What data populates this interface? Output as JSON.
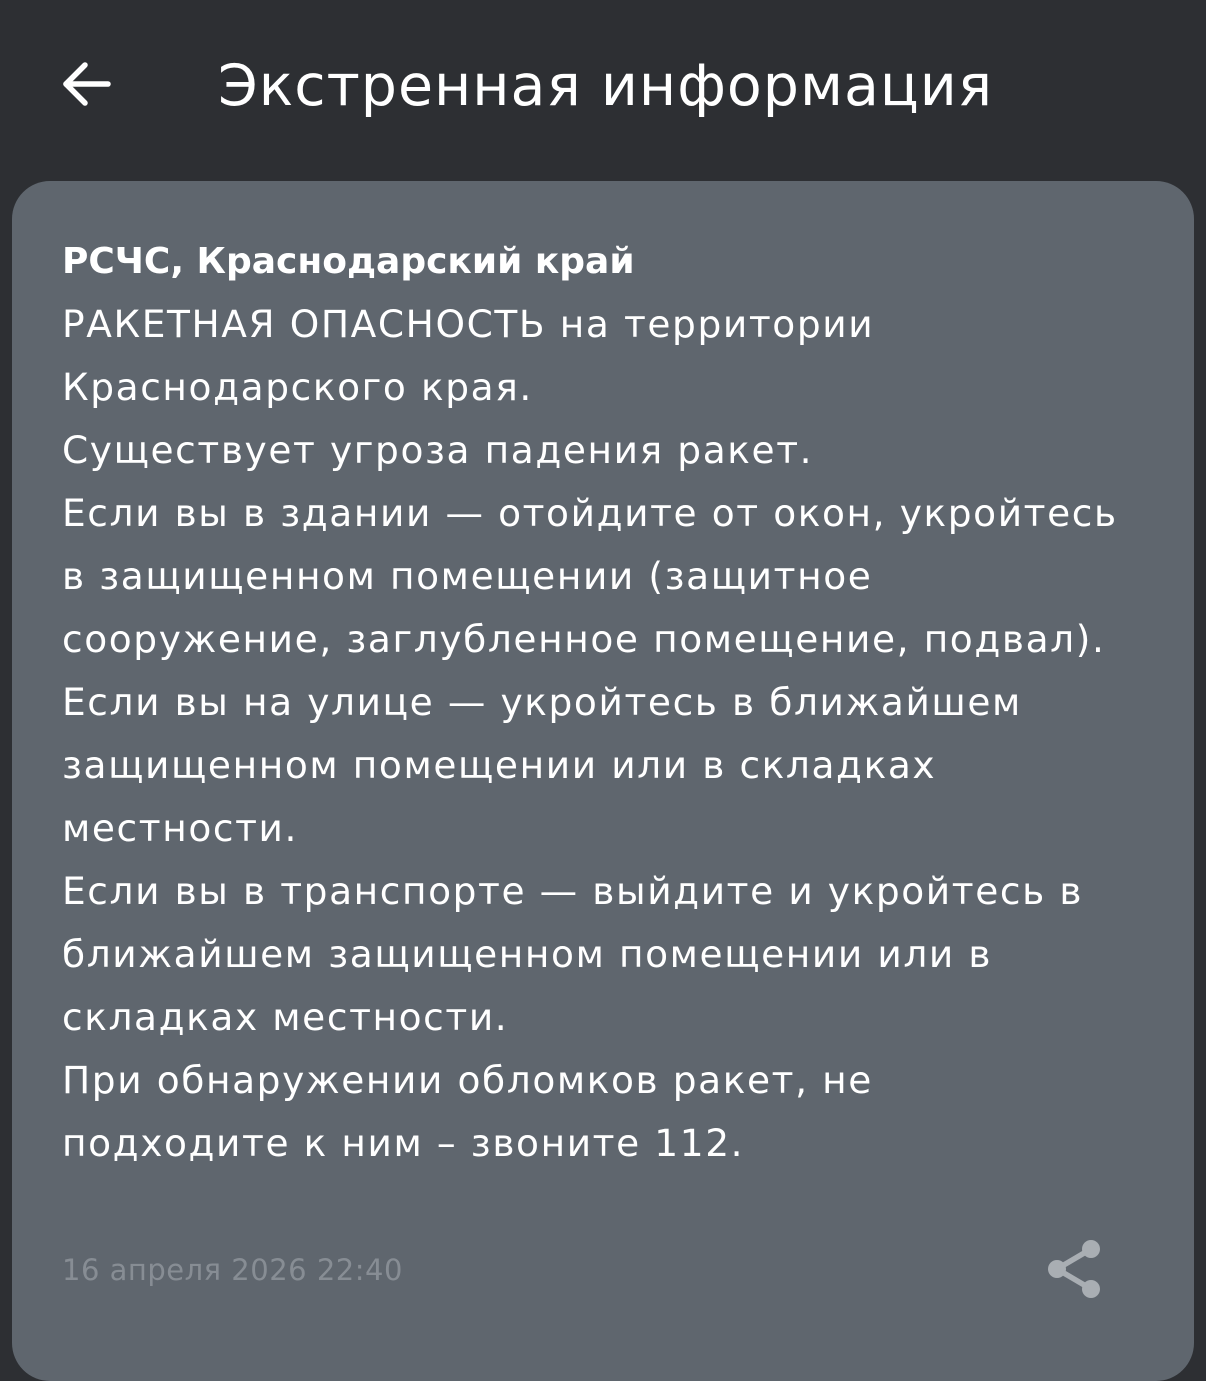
{
  "header": {
    "back_icon": "arrow-left-icon",
    "title": "Экстренная информация"
  },
  "alert": {
    "source": "РСЧС, Краснодарский край",
    "lines": [
      "РАКЕТНАЯ ОПАСНОСТЬ на территории",
      "Краснодарского края.",
      "Существует угроза падения ракет.",
      "Если вы в здании — отойдите от окон, укройтесь",
      "в защищенном помещении (защитное",
      "сооружение, заглубленное помещение, подвал).",
      "Если вы на улице — укройтесь в ближайшем",
      "защищенном помещении или в складках",
      "местности.",
      "Если вы в транспорте — выйдите и укройтесь в",
      "ближайшем защищенном помещении или в",
      "складках местности.",
      "При обнаружении обломков ракет, не",
      "подходите к ним – звоните 112."
    ],
    "timestamp": "16 апреля 2026 22:40",
    "share_icon": "share-icon"
  },
  "colors": {
    "background": "#2d2f33",
    "card": "#5f666e",
    "text": "#ffffff",
    "timestamp": "#878d94",
    "share_icon": "#a9aeb3"
  }
}
